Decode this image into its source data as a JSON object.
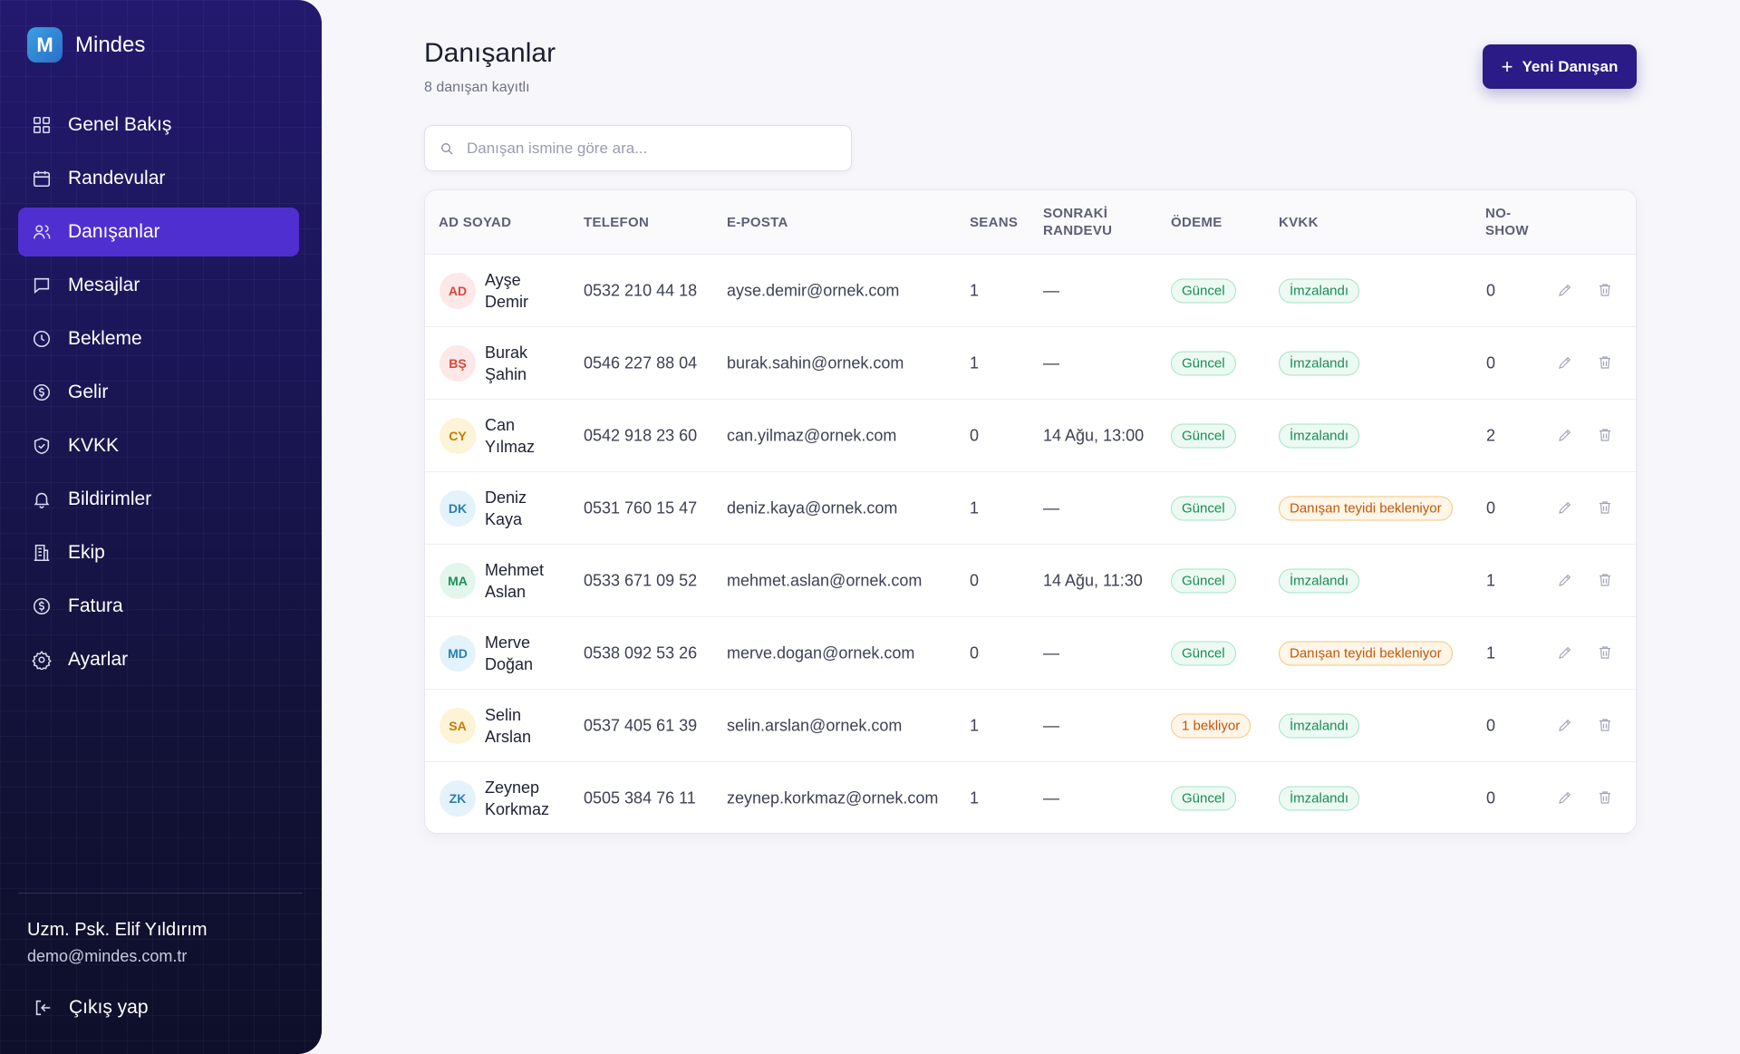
{
  "brand": {
    "logo_letter": "M",
    "name": "Mindes"
  },
  "nav": [
    {
      "label": "Genel Bakış",
      "icon": "grid-icon"
    },
    {
      "label": "Randevular",
      "icon": "calendar-icon"
    },
    {
      "label": "Danışanlar",
      "icon": "users-icon",
      "active": true
    },
    {
      "label": "Mesajlar",
      "icon": "message-icon"
    },
    {
      "label": "Bekleme",
      "icon": "clock-icon"
    },
    {
      "label": "Gelir",
      "icon": "coin-icon"
    },
    {
      "label": "KVKK",
      "icon": "shield-icon"
    },
    {
      "label": "Bildirimler",
      "icon": "bell-icon"
    },
    {
      "label": "Ekip",
      "icon": "building-icon"
    },
    {
      "label": "Fatura",
      "icon": "coin-icon"
    },
    {
      "label": "Ayarlar",
      "icon": "gear-icon"
    }
  ],
  "user": {
    "name": "Uzm. Psk. Elif Yıldırım",
    "email": "demo@mindes.com.tr",
    "logout_label": "Çıkış yap"
  },
  "page": {
    "title": "Danışanlar",
    "subtitle": "8 danışan kayıtlı",
    "new_button": "Yeni Danışan"
  },
  "search": {
    "placeholder": "Danışan ismine göre ara...",
    "value": ""
  },
  "table": {
    "headers": {
      "name": "AD SOYAD",
      "phone": "TELEFON",
      "email": "E-POSTA",
      "sessions": "SEANS",
      "next_1": "SONRAKİ",
      "next_2": "RANDEVU",
      "payment": "ÖDEME",
      "kvkk": "KVKK",
      "noshow_1": "NO-",
      "noshow_2": "SHOW"
    },
    "rows": [
      {
        "initials": "AD",
        "first": "Ayşe",
        "last": "Demir",
        "phone": "0532 210 44 18",
        "email": "ayse.demir@ornek.com",
        "sessions": "1",
        "next": "—",
        "payment": "Güncel",
        "payment_status": "green",
        "kvkk": "İmzalandı",
        "kvkk_status": "green",
        "noshow": "0",
        "avatar_bg": "#fde8e8",
        "avatar_fg": "#d9493a"
      },
      {
        "initials": "BŞ",
        "first": "Burak",
        "last": "Şahin",
        "phone": "0546 227 88 04",
        "email": "burak.sahin@ornek.com",
        "sessions": "1",
        "next": "—",
        "payment": "Güncel",
        "payment_status": "green",
        "kvkk": "İmzalandı",
        "kvkk_status": "green",
        "noshow": "0",
        "avatar_bg": "#fde8e8",
        "avatar_fg": "#d9493a"
      },
      {
        "initials": "CY",
        "first": "Can",
        "last": "Yılmaz",
        "phone": "0542 918 23 60",
        "email": "can.yilmaz@ornek.com",
        "sessions": "0",
        "next": "14 Ağu, 13:00",
        "payment": "Güncel",
        "payment_status": "green",
        "kvkk": "İmzalandı",
        "kvkk_status": "green",
        "noshow": "2",
        "avatar_bg": "#fdf3d6",
        "avatar_fg": "#c77a07"
      },
      {
        "initials": "DK",
        "first": "Deniz",
        "last": "Kaya",
        "phone": "0531 760 15 47",
        "email": "deniz.kaya@ornek.com",
        "sessions": "1",
        "next": "—",
        "payment": "Güncel",
        "payment_status": "green",
        "kvkk": "Danışan teyidi bekleniyor",
        "kvkk_status": "orange",
        "noshow": "0",
        "avatar_bg": "#e4f2fb",
        "avatar_fg": "#2a7fb3"
      },
      {
        "initials": "MA",
        "first": "Mehmet",
        "last": "Aslan",
        "phone": "0533 671 09 52",
        "email": "mehmet.aslan@ornek.com",
        "sessions": "0",
        "next": "14 Ağu, 11:30",
        "payment": "Güncel",
        "payment_status": "green",
        "kvkk": "İmzalandı",
        "kvkk_status": "green",
        "noshow": "1",
        "avatar_bg": "#e2f6ec",
        "avatar_fg": "#1f8f5a"
      },
      {
        "initials": "MD",
        "first": "Merve",
        "last": "Doğan",
        "phone": "0538 092 53 26",
        "email": "merve.dogan@ornek.com",
        "sessions": "0",
        "next": "—",
        "payment": "Güncel",
        "payment_status": "green",
        "kvkk": "Danışan teyidi bekleniyor",
        "kvkk_status": "orange",
        "noshow": "1",
        "avatar_bg": "#e4f2fb",
        "avatar_fg": "#2a7fb3"
      },
      {
        "initials": "SA",
        "first": "Selin",
        "last": "Arslan",
        "phone": "0537 405 61 39",
        "email": "selin.arslan@ornek.com",
        "sessions": "1",
        "next": "—",
        "payment": "1 bekliyor",
        "payment_status": "orange",
        "kvkk": "İmzalandı",
        "kvkk_status": "green",
        "noshow": "0",
        "avatar_bg": "#fdf3d6",
        "avatar_fg": "#c77a07"
      },
      {
        "initials": "ZK",
        "first": "Zeynep",
        "last": "Korkmaz",
        "phone": "0505 384 76 11",
        "email": "zeynep.korkmaz@ornek.com",
        "sessions": "1",
        "next": "—",
        "payment": "Güncel",
        "payment_status": "green",
        "kvkk": "İmzalandı",
        "kvkk_status": "green",
        "noshow": "0",
        "avatar_bg": "#e4f2fb",
        "avatar_fg": "#2a7fb3"
      }
    ]
  }
}
